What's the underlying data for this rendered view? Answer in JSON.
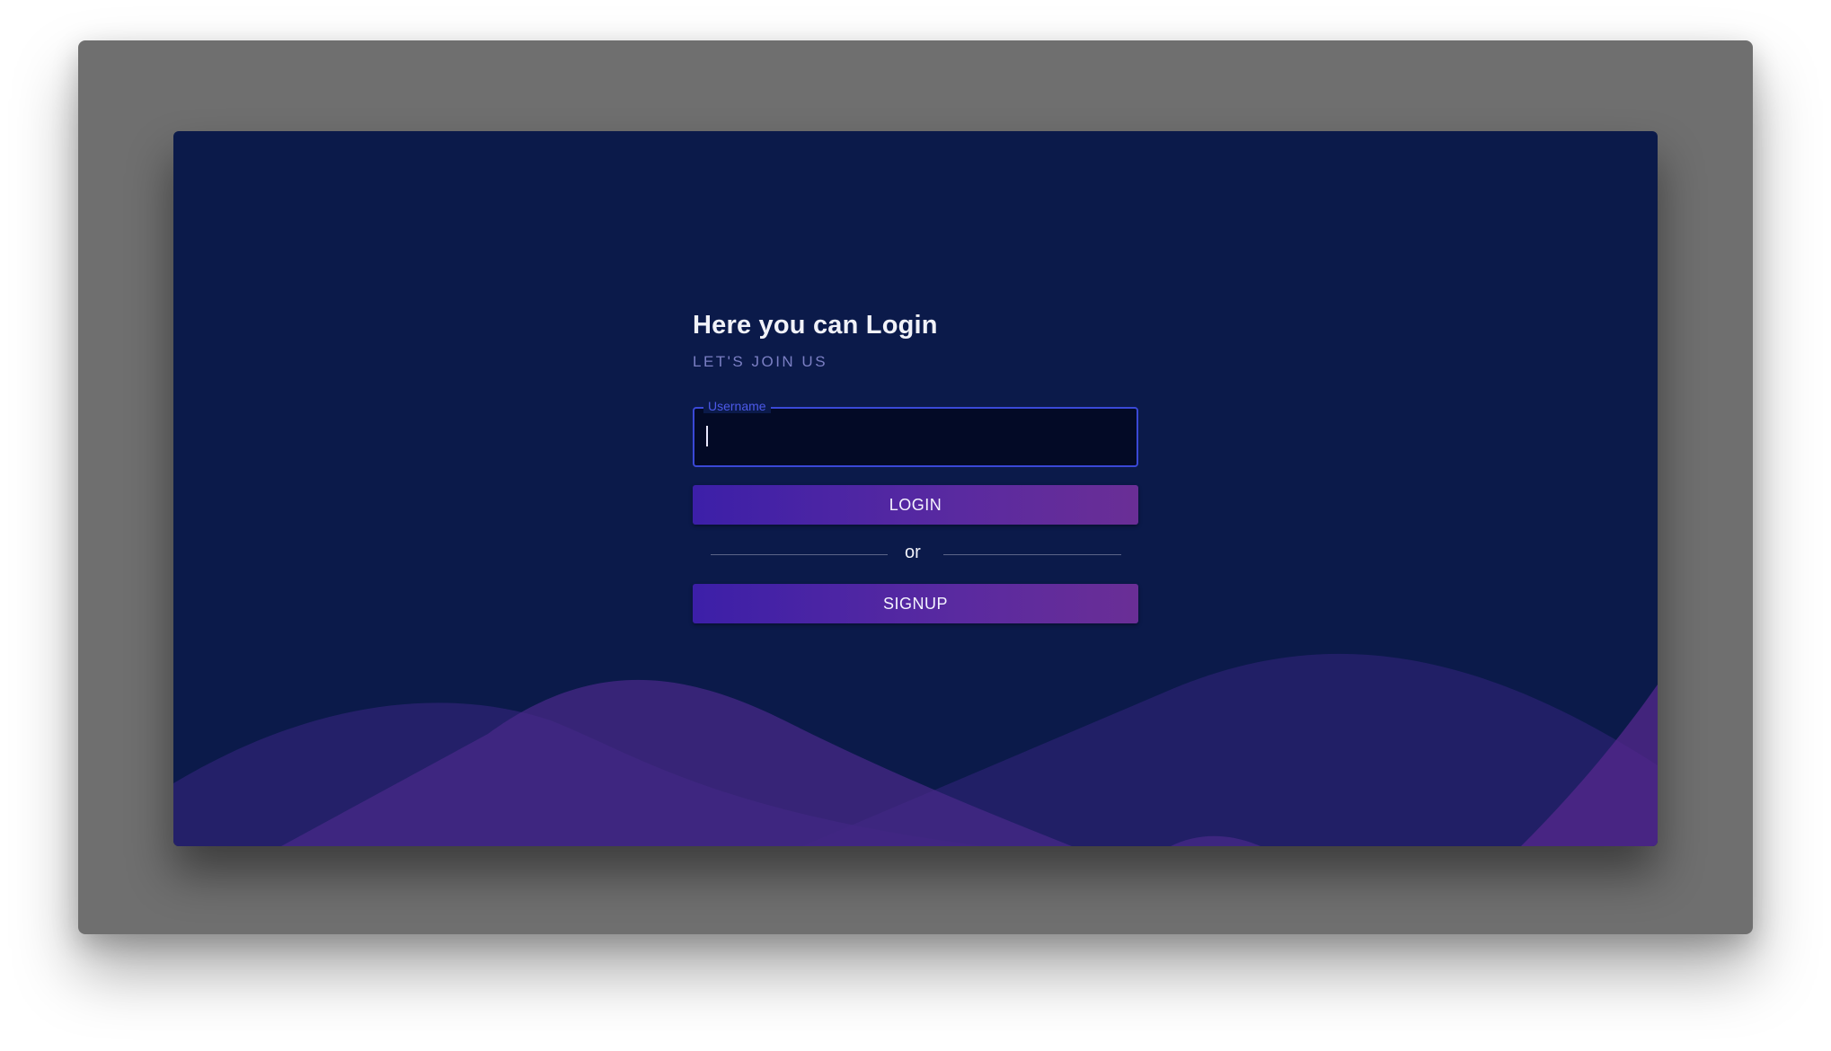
{
  "login": {
    "title": "Here you can Login",
    "subtitle": "LET'S JOIN US",
    "username": {
      "label": "Username",
      "value": "",
      "placeholder": ""
    },
    "login_button_label": "LOGIN",
    "divider_text": "or",
    "signup_button_label": "SIGNUP"
  },
  "colors": {
    "background": "#0b1a4a",
    "accent": "#3a48d6",
    "button_gradient_start": "#3c1fa8",
    "button_gradient_end": "#6a2e96",
    "wave_purple": "#4a2a8a",
    "frame": "#6f6f6f"
  }
}
